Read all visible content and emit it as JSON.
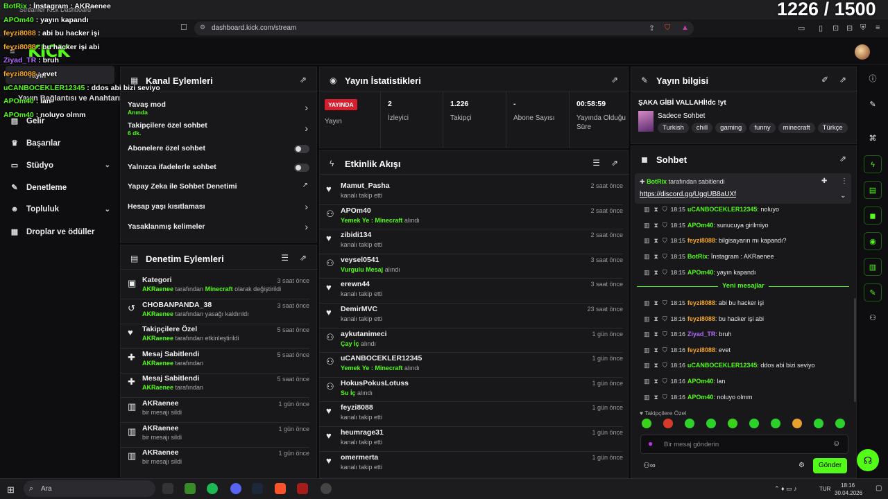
{
  "browser": {
    "tab_title": "Streamer Kick Dashboard",
    "url": "dashboard.kick.com/stream"
  },
  "viewer_counter": "1226 / 1500",
  "overlay_chat": [
    {
      "user": "BotRix",
      "text": " : İnstagram : AKRaenee",
      "color": "#53fc18"
    },
    {
      "user": "APOm40",
      "text": " : yayın kapandı",
      "color": "#53fc18"
    },
    {
      "user": "feyzi8088",
      "text": " : abi bu hacker işi",
      "color": "#f5a623"
    },
    {
      "user": "feyzi8088",
      "text": " : bu hacker işi abi",
      "color": "#f5a623"
    },
    {
      "user": "Ziyad_TR",
      "text": " : bruh",
      "color": "#b46cff"
    },
    {
      "user": "feyzi8088",
      "text": " : evet",
      "color": "#f5a623"
    },
    {
      "user": "uCANBOCEKLER12345",
      "text": " : ddos abi bizi seviyo",
      "color": "#53fc18"
    },
    {
      "user": "APOm40",
      "text": " : lan",
      "color": "#53fc18"
    },
    {
      "user": "APOm40",
      "text": " : noluyo olmm",
      "color": "#53fc18"
    }
  ],
  "leftnav": {
    "behind_1": "Yayın",
    "behind_2": "Yayın Bağlantısı ve Anahtarı",
    "items": [
      {
        "label": "Gelir",
        "icon": "money-icon",
        "glyph": "▤"
      },
      {
        "label": "Başarılar",
        "icon": "trophy-icon",
        "glyph": "♛"
      },
      {
        "label": "Stüdyo",
        "icon": "studio-icon",
        "glyph": "▭",
        "chev": "⌄"
      },
      {
        "label": "Denetleme",
        "icon": "wrench-icon",
        "glyph": "✎"
      },
      {
        "label": "Topluluk",
        "icon": "people-icon",
        "glyph": "☻",
        "chev": "⌄"
      },
      {
        "label": "Droplar ve ödüller",
        "icon": "drops-icon",
        "glyph": "▦"
      }
    ]
  },
  "kanal": {
    "title": "Kanal Eylemleri",
    "rows": [
      {
        "title": "Yavaş mod",
        "sub": "Anında",
        "control": "arrow"
      },
      {
        "title": "Takipçilere özel sohbet",
        "sub": "6 dk.",
        "control": "arrow"
      },
      {
        "title": "Abonelere özel sohbet",
        "sub": "",
        "control": "toggle"
      },
      {
        "title": "Yalnızca ifadelerle sohbet",
        "sub": "",
        "control": "toggle"
      },
      {
        "title": "Yapay Zeka ile Sohbet Denetimi",
        "sub": "",
        "control": "link"
      },
      {
        "title": "Hesap yaşı kısıtlaması",
        "sub": "",
        "control": "arrow"
      },
      {
        "title": "Yasaklanmış kelimeler",
        "sub": "",
        "control": "arrow"
      }
    ]
  },
  "stats": {
    "title": "Yayın İstatistikleri",
    "live_badge": "YAYINDA",
    "live_label": "Yayın",
    "items": [
      {
        "value": "2",
        "label": "İzleyici"
      },
      {
        "value": "1.226",
        "label": "Takipçi"
      },
      {
        "value": "-",
        "label": "Abone Sayısı"
      },
      {
        "value": "00:58:59",
        "label": "Yayında Olduğu Süre"
      }
    ]
  },
  "activity": {
    "title": "Etkinlik Akışı",
    "items": [
      {
        "name": "Mamut_Pasha",
        "pre": "",
        "hl": "",
        "sub": "kanalı takip etti",
        "time": "2 saat önce",
        "icon": "heart-icon",
        "glyph": "♥"
      },
      {
        "name": "APOm40",
        "pre": "",
        "hl": "Yemek Ye : Minecraft",
        "sub": " alındı",
        "time": "2 saat önce",
        "icon": "kick-points-icon",
        "glyph": "⚇"
      },
      {
        "name": "zibidi134",
        "pre": "",
        "hl": "",
        "sub": "kanalı takip etti",
        "time": "2 saat önce",
        "icon": "heart-icon",
        "glyph": "♥"
      },
      {
        "name": "veysel0541",
        "pre": "",
        "hl": "Vurgulu Mesaj",
        "sub": " alındı",
        "time": "3 saat önce",
        "icon": "kick-points-icon",
        "glyph": "⚇"
      },
      {
        "name": "erewn44",
        "pre": "",
        "hl": "",
        "sub": "kanalı takip etti",
        "time": "3 saat önce",
        "icon": "heart-icon",
        "glyph": "♥"
      },
      {
        "name": "DemirMVC",
        "pre": "",
        "hl": "",
        "sub": "kanalı takip etti",
        "time": "23 saat önce",
        "icon": "heart-icon",
        "glyph": "♥"
      },
      {
        "name": "aykutanimeci",
        "pre": "",
        "hl": "Çay İç",
        "sub": " alındı",
        "time": "1 gün önce",
        "icon": "kick-points-icon",
        "glyph": "⚇"
      },
      {
        "name": "uCANBOCEKLER12345",
        "pre": "",
        "hl": "Yemek Ye : Minecraft",
        "sub": " alındı",
        "time": "1 gün önce",
        "icon": "kick-points-icon",
        "glyph": "⚇"
      },
      {
        "name": "HokusPokusLotuss",
        "pre": "",
        "hl": "Su İç",
        "sub": " alındı",
        "time": "1 gün önce",
        "icon": "kick-points-icon",
        "glyph": "⚇"
      },
      {
        "name": "feyzi8088",
        "pre": "",
        "hl": "",
        "sub": "kanalı takip etti",
        "time": "1 gün önce",
        "icon": "heart-icon",
        "glyph": "♥"
      },
      {
        "name": "heumrage31",
        "pre": "",
        "hl": "",
        "sub": "kanalı takip etti",
        "time": "1 gün önce",
        "icon": "heart-icon",
        "glyph": "♥"
      },
      {
        "name": "omermerta",
        "pre": "",
        "hl": "",
        "sub": "kanalı takip etti",
        "time": "1 gün önce",
        "icon": "heart-icon",
        "glyph": "♥"
      }
    ]
  },
  "denetim": {
    "title": "Denetim Eylemleri",
    "items": [
      {
        "title": "Kategori",
        "actor": "AKRaenee",
        "mid": " tarafından ",
        "hl": "Minecraft",
        "rest": " olarak değiştirildi",
        "time": "3 saat önce",
        "icon": "category-icon",
        "glyph": "▣"
      },
      {
        "title": "CHOBANPANDA_38",
        "actor": "AKRaenee",
        "mid": " tarafından yasağı kaldırıldı",
        "hl": "",
        "rest": "",
        "time": "3 saat önce",
        "icon": "unban-icon",
        "glyph": "↺"
      },
      {
        "title": "Takipçilere Özel",
        "actor": "AKRaenee",
        "mid": " tarafından etkinleştirildi",
        "hl": "",
        "rest": "",
        "time": "5 saat önce",
        "icon": "heart-icon",
        "glyph": "♥"
      },
      {
        "title": "Mesaj Sabitlendi",
        "actor": "AKRaenee",
        "mid": " tarafından",
        "hl": "",
        "rest": "",
        "time": "5 saat önce",
        "icon": "pin-icon",
        "glyph": "✚"
      },
      {
        "title": "Mesaj Sabitlendi",
        "actor": "AKRaenee",
        "mid": " tarafından",
        "hl": "",
        "rest": "",
        "time": "5 saat önce",
        "icon": "pin-icon",
        "glyph": "✚"
      },
      {
        "title": "AKRaenee",
        "actor": "",
        "mid": "bir mesajı sildi",
        "hl": "",
        "rest": "",
        "time": "1 gün önce",
        "icon": "trash-icon",
        "glyph": "▥"
      },
      {
        "title": "AKRaenee",
        "actor": "",
        "mid": "bir mesajı sildi",
        "hl": "",
        "rest": "",
        "time": "1 gün önce",
        "icon": "trash-icon",
        "glyph": "▥"
      },
      {
        "title": "AKRaenee",
        "actor": "",
        "mid": "bir mesajı sildi",
        "hl": "",
        "rest": "",
        "time": "1 gün önce",
        "icon": "trash-icon",
        "glyph": "▥"
      }
    ]
  },
  "info": {
    "title": "Yayın bilgisi",
    "stream_title": "ŞAKA GİBİ VALLAHİ!dc !yt",
    "category": "Sadece Sohbet",
    "tags": [
      "Turkish",
      "chill",
      "gaming",
      "funny",
      "minecraft",
      "Türkçe"
    ]
  },
  "chat": {
    "title": "Sohbet",
    "pinned_user": "BotRix",
    "pinned_by": " tarafından sabitlendi",
    "pinned_link": "https://discord.gg/UggUB8aUXf",
    "new_messages": "Yeni mesajlar",
    "messages": [
      {
        "time": "18:15",
        "user": "uCANBOCEKLER12345",
        "cls": "u-green",
        "text": ": noluyo"
      },
      {
        "time": "18:15",
        "user": "APOm40",
        "cls": "u-green",
        "text": ": sunucuya girilmiyo"
      },
      {
        "time": "18:15",
        "user": "feyzi8088",
        "cls": "u-orange",
        "text": ": bilgisayarın mı kapandı?"
      },
      {
        "time": "18:15",
        "user": "BotRix",
        "cls": "u-green",
        "text": ": İnstagram : AKRaenee"
      },
      {
        "time": "18:15",
        "user": "APOm40",
        "cls": "u-green",
        "text": ": yayın kapandı"
      },
      {
        "time": "18:15",
        "user": "feyzi8088",
        "cls": "u-orange",
        "text": ": abi bu hacker işi"
      },
      {
        "time": "18:16",
        "user": "feyzi8088",
        "cls": "u-orange",
        "text": ": bu hacker işi abi"
      },
      {
        "time": "18:16",
        "user": "Ziyad_TR",
        "cls": "u-purple",
        "text": ": bruh"
      },
      {
        "time": "18:16",
        "user": "feyzi8088",
        "cls": "u-orange",
        "text": ": evet"
      },
      {
        "time": "18:16",
        "user": "uCANBOCEKLER12345",
        "cls": "u-green",
        "text": ": ddos abi bizi seviyo"
      },
      {
        "time": "18:16",
        "user": "APOm40",
        "cls": "u-green",
        "text": ": lan"
      },
      {
        "time": "18:16",
        "user": "APOm40",
        "cls": "u-green",
        "text": ": noluyo olmm"
      }
    ],
    "mode_label": "Takipçilere Özel",
    "input_placeholder": "Bir mesaj gönderin",
    "send_label": "Gönder"
  },
  "taskbar": {
    "search": "Ara",
    "time": "18:16",
    "date": "30.04.2026",
    "lang": "TUR"
  },
  "colors": {
    "accent": "#53fc18",
    "live": "#d61f2c"
  }
}
